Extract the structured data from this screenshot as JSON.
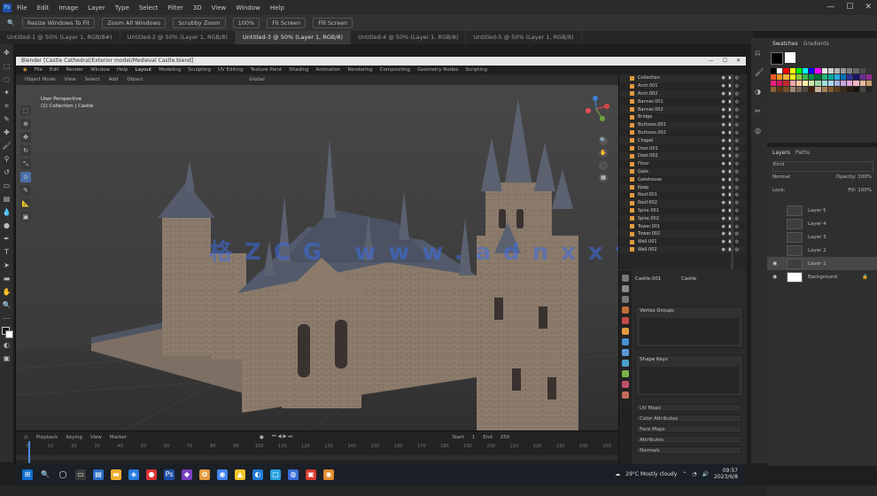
{
  "photoshop": {
    "menu": [
      "File",
      "Edit",
      "Image",
      "Layer",
      "Type",
      "Select",
      "Filter",
      "3D",
      "View",
      "Window",
      "Help"
    ],
    "options": {
      "zoom_icon": "magnifier-icon",
      "resize_label": "Resize Windows To Fit",
      "zoom_all_label": "Zoom All Windows",
      "scrubby_label": "Scrubby Zoom",
      "pct": "100%",
      "fit_label": "Fit Screen",
      "fill_label": "Fill Screen"
    },
    "tabs": [
      "Untitled-1 @ 50% (Layer 1, RGB/8#)",
      "Untitled-2 @ 50% (Layer 1, RGB/8)",
      "Untitled-3 @ 50% (Layer 1, RGB/8)",
      "Untitled-4 @ 50% (Layer 1, RGB/8)",
      "Untitled-5 @ 50% (Layer 1, RGB/8)"
    ],
    "active_tab": 2,
    "panels": {
      "swatches_tab": "Swatches",
      "gradients_tab": "Gradients",
      "layers_tab": "Layers",
      "channels_tab": "Paths",
      "kind_label": "Kind",
      "normal_label": "Normal",
      "opacity_label": "Opacity:",
      "opacity_value": "100%",
      "lock_label": "Lock:",
      "fill_label": "Fill:",
      "fill_value": "100%"
    },
    "layers": [
      "Layer 5",
      "Layer 4",
      "Layer 3",
      "Layer 2",
      "Layer 1",
      "Background"
    ],
    "selected_layer": 4,
    "swatch_colors": [
      "#000000",
      "#ffffff",
      "#ff0000",
      "#ffff00",
      "#00ff00",
      "#00ffff",
      "#0000ff",
      "#ff00ff",
      "#e8e8e8",
      "#cfcfcf",
      "#b5b5b5",
      "#9b9b9b",
      "#808080",
      "#666",
      "#4d4d4d",
      "#333",
      "#f15a24",
      "#f7931e",
      "#fbb03b",
      "#fcee21",
      "#8cc63f",
      "#39b54a",
      "#009245",
      "#006837",
      "#22b573",
      "#00a99d",
      "#29abe2",
      "#0071bc",
      "#2e3192",
      "#1b1464",
      "#662d91",
      "#93278f",
      "#ed1e79",
      "#d4145a",
      "#c1272d",
      "#f4a6a6",
      "#f8c99d",
      "#fff2a8",
      "#c8e6a5",
      "#a5d6a7",
      "#a0e0d8",
      "#a8d8f0",
      "#a5b4e0",
      "#c8a8e0",
      "#e0a8d8",
      "#f5b5c8",
      "#e6b89c",
      "#c69c6d",
      "#8c6239",
      "#603813",
      "#754c24",
      "#998675",
      "#736357",
      "#534741",
      "#42210b",
      "#c7b299",
      "#a67c52",
      "#7f5a2e",
      "#5a3e1b",
      "#3c2a14",
      "#2a1d0e",
      "#1a1209",
      "#444",
      "#222"
    ]
  },
  "blender": {
    "title": "Blender [Castle Cathedral/Exterior model/Medieval Castle.blend]",
    "menu": [
      "File",
      "Edit",
      "Render",
      "Window",
      "Help",
      "Layout",
      "Modeling",
      "Sculpting",
      "UV Editing",
      "Texture Paint",
      "Shading",
      "Animation",
      "Rendering",
      "Compositing",
      "Geometry Nodes",
      "Scripting"
    ],
    "header": [
      "Object Mode",
      "View",
      "Select",
      "Add",
      "Object",
      "Global"
    ],
    "viewport_info": [
      "User Perspective",
      "(1) Collection | Castle"
    ],
    "watermark": "格ZCG www.adnxxfb.com",
    "outliner_items": [
      "Collection",
      "Arch.001",
      "Arch.002",
      "Banner.001",
      "Banner.002",
      "Bridge",
      "Buttress.001",
      "Buttress.002",
      "Chapel",
      "Door.001",
      "Door.002",
      "Floor",
      "Gate",
      "Gatehouse",
      "Keep",
      "Roof.001",
      "Roof.002",
      "Spire.001",
      "Spire.002",
      "Tower.001",
      "Tower.002",
      "Wall.001",
      "Wall.002"
    ],
    "props": {
      "object_label": "Castle.001",
      "sub_label": "Castle",
      "panel1": "Vertex Groups",
      "panel2": "Shape Keys",
      "sub1": "UV Maps",
      "sub2": "Color Attributes",
      "sub3": "Face Maps",
      "sub4": "Attributes",
      "sub5": "Normals"
    },
    "timeline": {
      "controls": [
        "Playback",
        "Keying",
        "View",
        "Marker"
      ],
      "ticks": [
        "0",
        "10",
        "20",
        "30",
        "40",
        "50",
        "60",
        "70",
        "80",
        "90",
        "100",
        "110",
        "120",
        "130",
        "140",
        "150",
        "160",
        "170",
        "180",
        "190",
        "200",
        "210",
        "220",
        "230",
        "240",
        "250"
      ],
      "start": "Start",
      "start_val": "1",
      "end": "End",
      "end_val": "250"
    }
  },
  "taskbar": {
    "weather": "29°C Mostly cloudy",
    "time": "09:57",
    "date": "2023/6/8"
  },
  "accent_colors": {
    "blender_orange": "#e39b3c",
    "ps_blue": "#1d4fa8",
    "selection": "#4a6fa8"
  }
}
